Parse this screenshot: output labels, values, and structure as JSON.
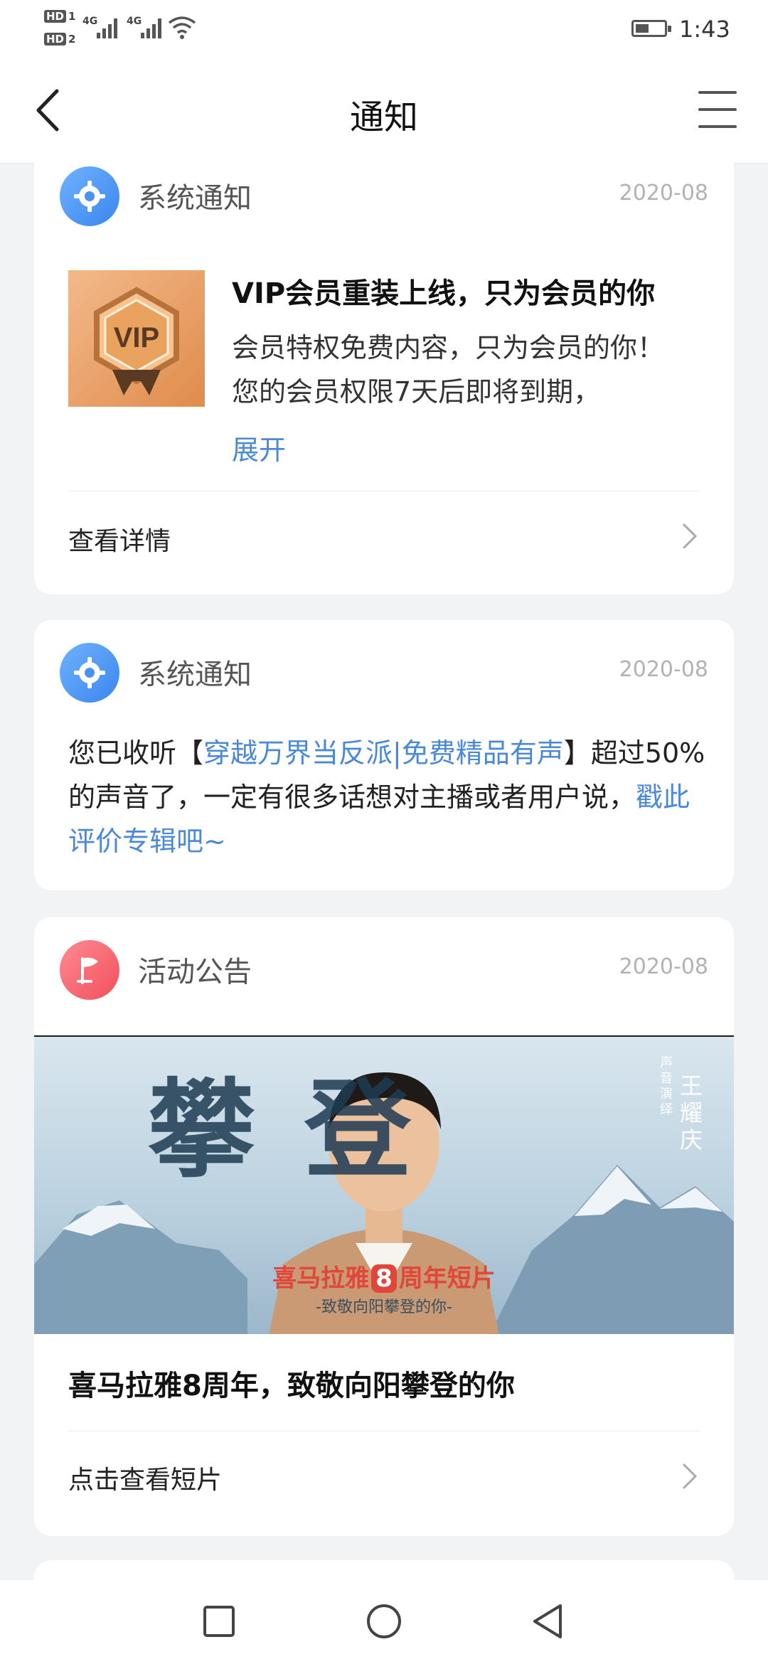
{
  "status_bar": {
    "hd1": "HD",
    "hd1_sub": "1",
    "hd2": "HD",
    "hd2_sub": "2",
    "net1": "4G",
    "net2": "4G",
    "time": "1:43"
  },
  "nav": {
    "title": "通知"
  },
  "cards": [
    {
      "category": "系统通知",
      "date": "2020-08",
      "title": "VIP会员重装上线，只为会员的你",
      "desc": "会员特权免费内容，只为会员的你！您的会员权限7天后即将到期，",
      "expand": "展开",
      "action": "查看详情",
      "image_text": "VIP"
    },
    {
      "category": "系统通知",
      "date": "2020-08",
      "text_pre": "您已收听【",
      "text_link": "穿越万界当反派|免费精品有声",
      "text_mid": "】超过50%的声音了，一定有很多话想对主播或者用户说，",
      "text_link2": "戳此评价专辑吧~"
    },
    {
      "category": "活动公告",
      "date": "2020-08",
      "banner_callig": "攀登",
      "banner_side_small": "声音演绎",
      "banner_side_name": "王耀庆",
      "banner_sub_pre": "喜马拉雅",
      "banner_sub_num": "8",
      "banner_sub_post": "周年短片",
      "banner_tagline": "-致敬向阳攀登的你-",
      "title": "喜马拉雅8周年，致敬向阳攀登的你",
      "action": "点击查看短片"
    }
  ],
  "icons": {
    "back": "chevron-left-icon",
    "menu": "hamburger-menu-icon",
    "system": "gear-icon",
    "activity": "flag-icon",
    "row_arrow": "chevron-right-icon"
  },
  "colors": {
    "link": "#4a88d8",
    "system_icon": "#3b86ee",
    "activity_icon": "#f0505c",
    "page_bg": "#f2f3f5"
  }
}
